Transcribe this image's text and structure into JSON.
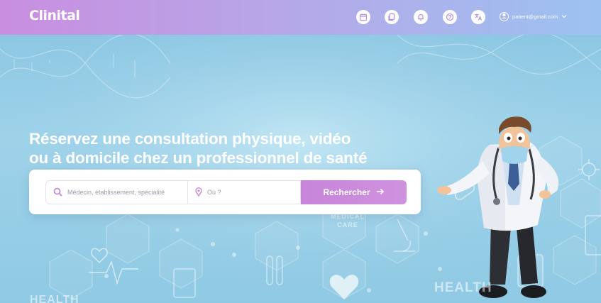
{
  "header": {
    "logo": "Clinital",
    "icons": [
      "calendar-icon",
      "documents-icon",
      "bell-icon",
      "help-icon",
      "translate-icon"
    ],
    "user_email": "patient@gmail.com"
  },
  "hero": {
    "headline_line1": "Réservez une consultation physique, vidéo",
    "headline_line2": "ou à domicile chez un professionnel de santé",
    "deco_medical_care": "MEDICAL CARE",
    "deco_health_left": "HEALTH",
    "deco_health_right": "HEALTH"
  },
  "search": {
    "what_placeholder": "Médecin, établissement, spécialité",
    "where_placeholder": "Où ?",
    "button_label": "Rechercher"
  },
  "colors": {
    "accent": "#c785d9",
    "header_start": "#c98ee0",
    "header_end": "#9cc2f1",
    "icon_color": "#b98fe0"
  }
}
